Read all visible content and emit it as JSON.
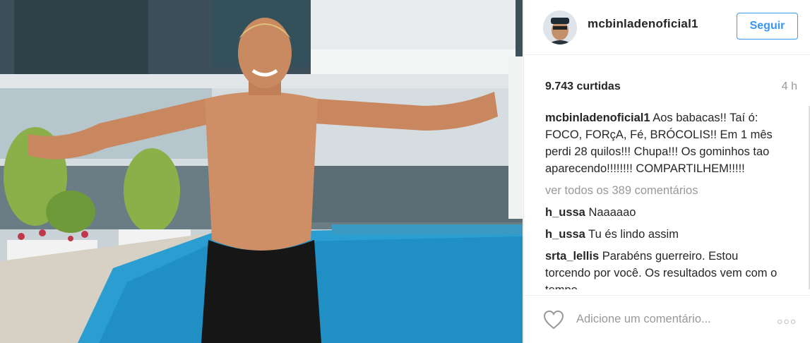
{
  "post": {
    "image_alt": "man with arms outstretched by pool"
  },
  "header": {
    "username": "mcbinladenoficial1",
    "follow_label": "Seguir"
  },
  "stats": {
    "likes": "9.743 curtidas",
    "time": "4 h"
  },
  "caption": {
    "user": "mcbinladenoficial1",
    "text": "Aos babacas!! Taí ó: FOCO, FORçA, Fé, BRÓCOLIS!! Em 1 mês perdi 28 quilos!!! Chupa!!! Os gominhos tao aparecendo!!!!!!!! COMPARTILHEM!!!!!"
  },
  "view_all": "ver todos os 389 comentários",
  "comments": [
    {
      "user": "h_ussa",
      "text": "Naaaaao"
    },
    {
      "user": "h_ussa",
      "text": "Tu és lindo assim"
    },
    {
      "user": "srta_lellis",
      "text": "Parabéns guerreiro. Estou torcendo por você. Os resultados vem com o tempo."
    }
  ],
  "footer": {
    "add_comment_placeholder": "Adicione um comentário...",
    "more_label": "○○○"
  },
  "colors": {
    "accent": "#3897f0",
    "text": "#262626",
    "muted": "#999999"
  }
}
